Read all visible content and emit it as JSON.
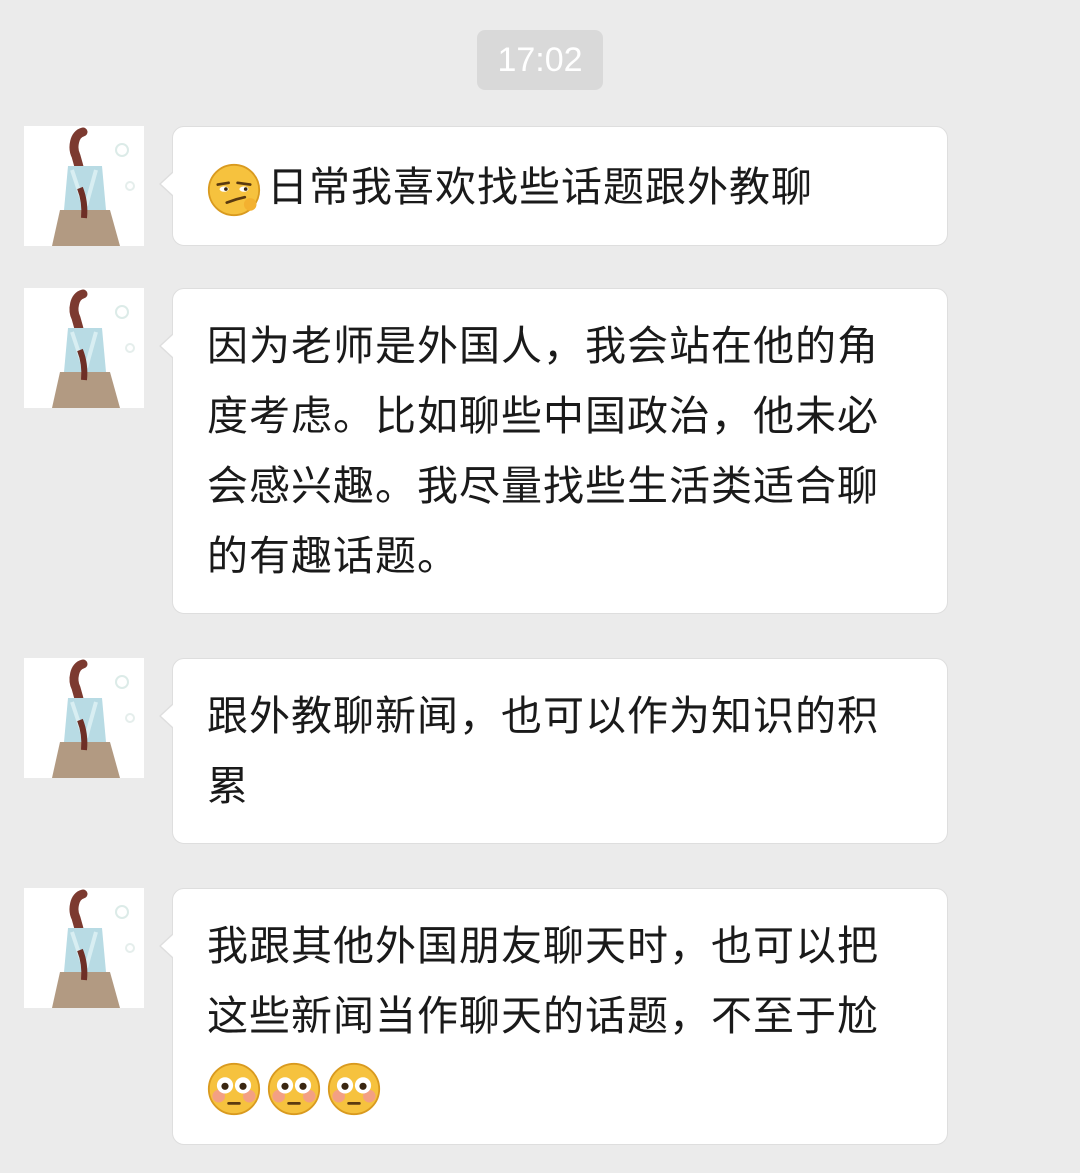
{
  "chat": {
    "timestamp": "17:02",
    "messages": [
      {
        "sender": "avatar",
        "leading_emoji": "smirk-emoji",
        "text": "日常我喜欢找些话题跟外教聊",
        "trailing_emojis": []
      },
      {
        "sender": "avatar",
        "leading_emoji": null,
        "text": "因为老师是外国人，我会站在他的角度考虑。比如聊些中国政治，他未必会感兴趣。我尽量找些生活类适合聊的有趣话题。",
        "trailing_emojis": []
      },
      {
        "sender": "avatar",
        "leading_emoji": null,
        "text": "跟外教聊新闻，也可以作为知识的积累",
        "trailing_emojis": []
      },
      {
        "sender": "avatar",
        "leading_emoji": null,
        "text": "我跟其他外国朋友聊天时，也可以把这些新闻当作聊天的话题，不至于尬",
        "trailing_emojis": [
          "flushed-emoji",
          "flushed-emoji",
          "flushed-emoji"
        ]
      }
    ]
  },
  "colors": {
    "background": "#ebebeb",
    "bubble": "#ffffff",
    "timestamp_bg": "#d9d9d9",
    "text": "#1a1a1a"
  }
}
